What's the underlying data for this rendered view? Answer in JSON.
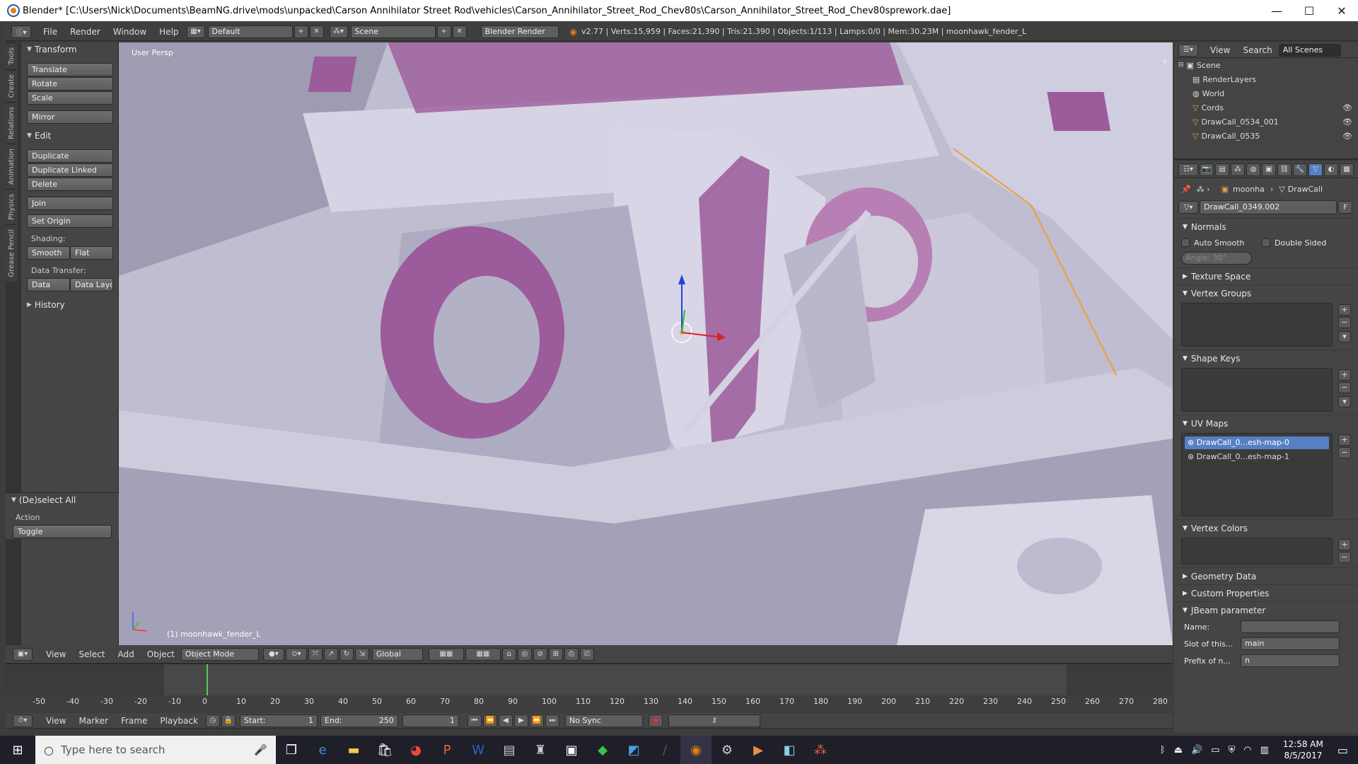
{
  "titlebar": {
    "title": "Blender* [C:\\Users\\Nick\\Documents\\BeamNG.drive\\mods\\unpacked\\Carson Annihilator Street Rod\\vehicles\\Carson_Annihilator_Street_Rod_Chev80s\\Carson_Annihilator_Street_Rod_Chev80sprework.dae]",
    "minimize": "—",
    "maximize": "☐",
    "close": "✕"
  },
  "info_header": {
    "menus": [
      "File",
      "Render",
      "Window",
      "Help"
    ],
    "layout": "Default",
    "scene": "Scene",
    "engine": "Blender Render",
    "stats": "v2.77 | Verts:15,959 | Faces:21,390 | Tris:21,390 | Objects:1/113 | Lamps:0/0 | Mem:30.23M | moonhawk_fender_L"
  },
  "tool_tabs": [
    "Tools",
    "Create",
    "Relations",
    "Animation",
    "Physics",
    "Grease Pencil"
  ],
  "toolshelf": {
    "transform": {
      "title": "Transform",
      "buttons": [
        "Translate",
        "Rotate",
        "Scale",
        "Mirror"
      ]
    },
    "edit": {
      "title": "Edit",
      "buttons": [
        "Duplicate",
        "Duplicate Linked",
        "Delete",
        "Join"
      ],
      "set_origin": "Set Origin",
      "shading_label": "Shading:",
      "smooth": "Smooth",
      "flat": "Flat",
      "data_transfer_label": "Data Transfer:",
      "data": "Data",
      "data_layout": "Data Layo"
    },
    "history": "History",
    "operator": {
      "title": "(De)select All",
      "action_label": "Action",
      "action_value": "Toggle"
    }
  },
  "viewport": {
    "view_label": "User Persp",
    "object_label": "(1) moonhawk_fender_L",
    "colors": {
      "body": "#c8c6d8",
      "accent": "#9c5b9a",
      "selection": "#f0a030"
    }
  },
  "viewport_header": {
    "menus": [
      "View",
      "Select",
      "Add",
      "Object"
    ],
    "mode": "Object Mode",
    "orientation": "Global"
  },
  "outliner": {
    "menus": [
      "View",
      "Search"
    ],
    "filter": "All Scenes",
    "items": [
      "Scene",
      "RenderLayers",
      "World",
      "Cords",
      "DrawCall_0534_001",
      "DrawCall_0535"
    ]
  },
  "properties": {
    "breadcrumb": [
      "moonha",
      "DrawCall"
    ],
    "mesh_name": "DrawCall_0349.002",
    "fake_user": "F",
    "normals": {
      "title": "Normals",
      "auto_smooth": "Auto Smooth",
      "double_sided": "Double Sided",
      "angle": "Angle:     30°"
    },
    "sections": [
      "Texture Space",
      "Vertex Groups",
      "Shape Keys",
      "UV Maps",
      "Vertex Colors",
      "Geometry Data",
      "Custom Properties",
      "JBeam parameter"
    ],
    "uv_maps": [
      "DrawCall_0...esh-map-0",
      "DrawCall_0...esh-map-1"
    ],
    "jbeam": {
      "name_label": "Name:",
      "name_value": "",
      "slot_label": "Slot of this...",
      "slot_value": "main",
      "prefix_label": "Prefix of n...",
      "prefix_value": "n"
    }
  },
  "timeline": {
    "ticks": [
      "-50",
      "-40",
      "-30",
      "-20",
      "-10",
      "0",
      "10",
      "20",
      "30",
      "40",
      "50",
      "60",
      "70",
      "80",
      "90",
      "100",
      "110",
      "120",
      "130",
      "140",
      "150",
      "160",
      "170",
      "180",
      "190",
      "200",
      "210",
      "220",
      "230",
      "240",
      "250",
      "260",
      "270",
      "280"
    ],
    "current_frame_marker": 0
  },
  "timeline_header": {
    "menus": [
      "View",
      "Marker",
      "Frame",
      "Playback"
    ],
    "start": "Start:",
    "start_value": "1",
    "end": "End:",
    "end_value": "250",
    "current": "1",
    "sync": "No Sync"
  },
  "taskbar": {
    "search_placeholder": "Type here to search",
    "time": "12:58 AM",
    "date": "8/5/2017"
  }
}
